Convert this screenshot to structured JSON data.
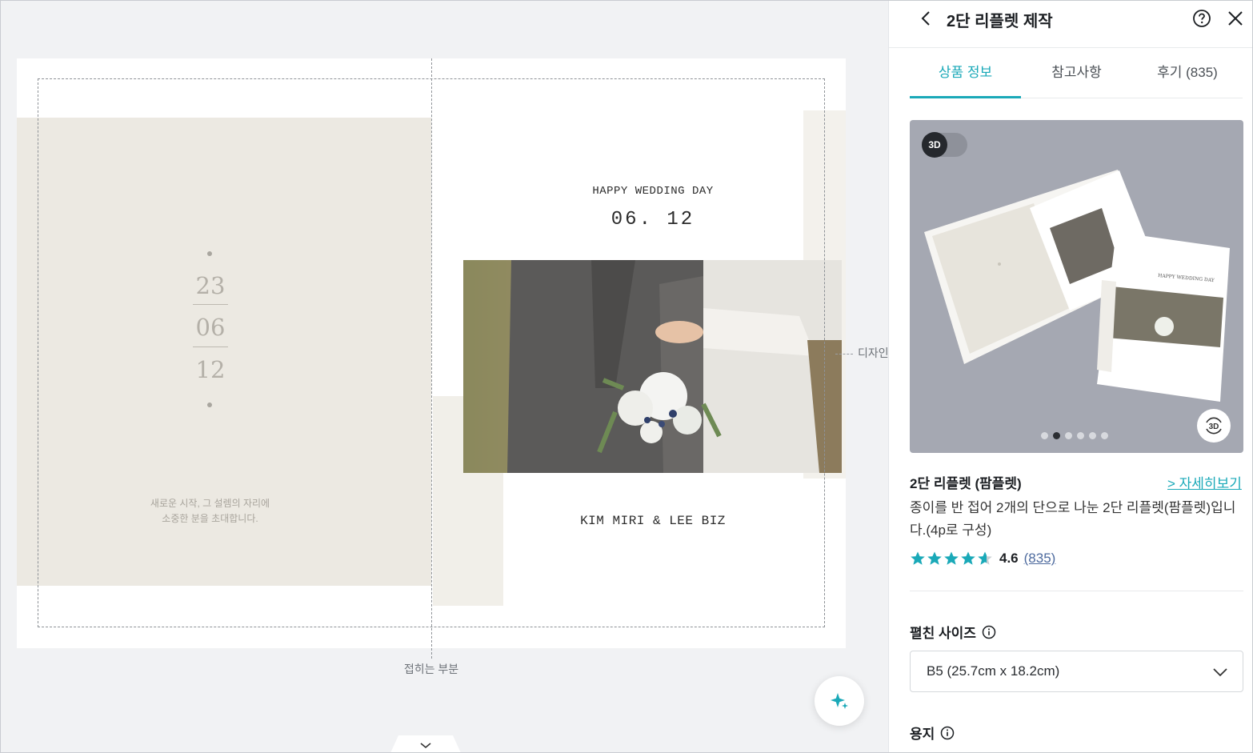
{
  "canvas": {
    "left_page": {
      "date_lines": [
        "23",
        "06",
        "12"
      ],
      "invite_lines": [
        "새로운 시작, 그 설렘의 자리에",
        "소중한 분을 초대합니다."
      ]
    },
    "right_page": {
      "title": "HAPPY WEDDING DAY",
      "date": "06. 12",
      "names": "KIM MIRI & LEE BIZ"
    },
    "fold_label": "접히는 부분",
    "design_label": "디자인"
  },
  "panel": {
    "title": "2단 리플렛 제작",
    "tabs": [
      {
        "label": "상품 정보",
        "active": true
      },
      {
        "label": "참고사항",
        "active": false
      },
      {
        "label": "후기 (835)",
        "active": false
      }
    ],
    "preview": {
      "toggle_label": "3D",
      "view3d_label": "3D",
      "dots": 6,
      "active_dot": 1
    },
    "product": {
      "name": "2단 리플렛 (팜플렛)",
      "detail_link": "> 자세히보기",
      "description": "종이를 반 접어 2개의 단으로 나눈 2단 리플렛(팜플렛)입니다.(4p로 구성)",
      "rating_value": "4.6",
      "rating_stars": 4.6,
      "rating_count": "(835)"
    },
    "size_field": {
      "label": "펼친 사이즈",
      "value": "B5 (25.7cm x 18.2cm)"
    },
    "paper_field": {
      "label": "용지"
    }
  },
  "colors": {
    "accent": "#1aa9b8",
    "star": "#1aa9b8",
    "beige": "#ece9e2"
  },
  "icons": [
    "chevron-left-icon",
    "help-circle-icon",
    "close-icon",
    "info-icon",
    "chevron-down-icon",
    "sparkle-icon",
    "star-icon",
    "view-3d-icon"
  ]
}
